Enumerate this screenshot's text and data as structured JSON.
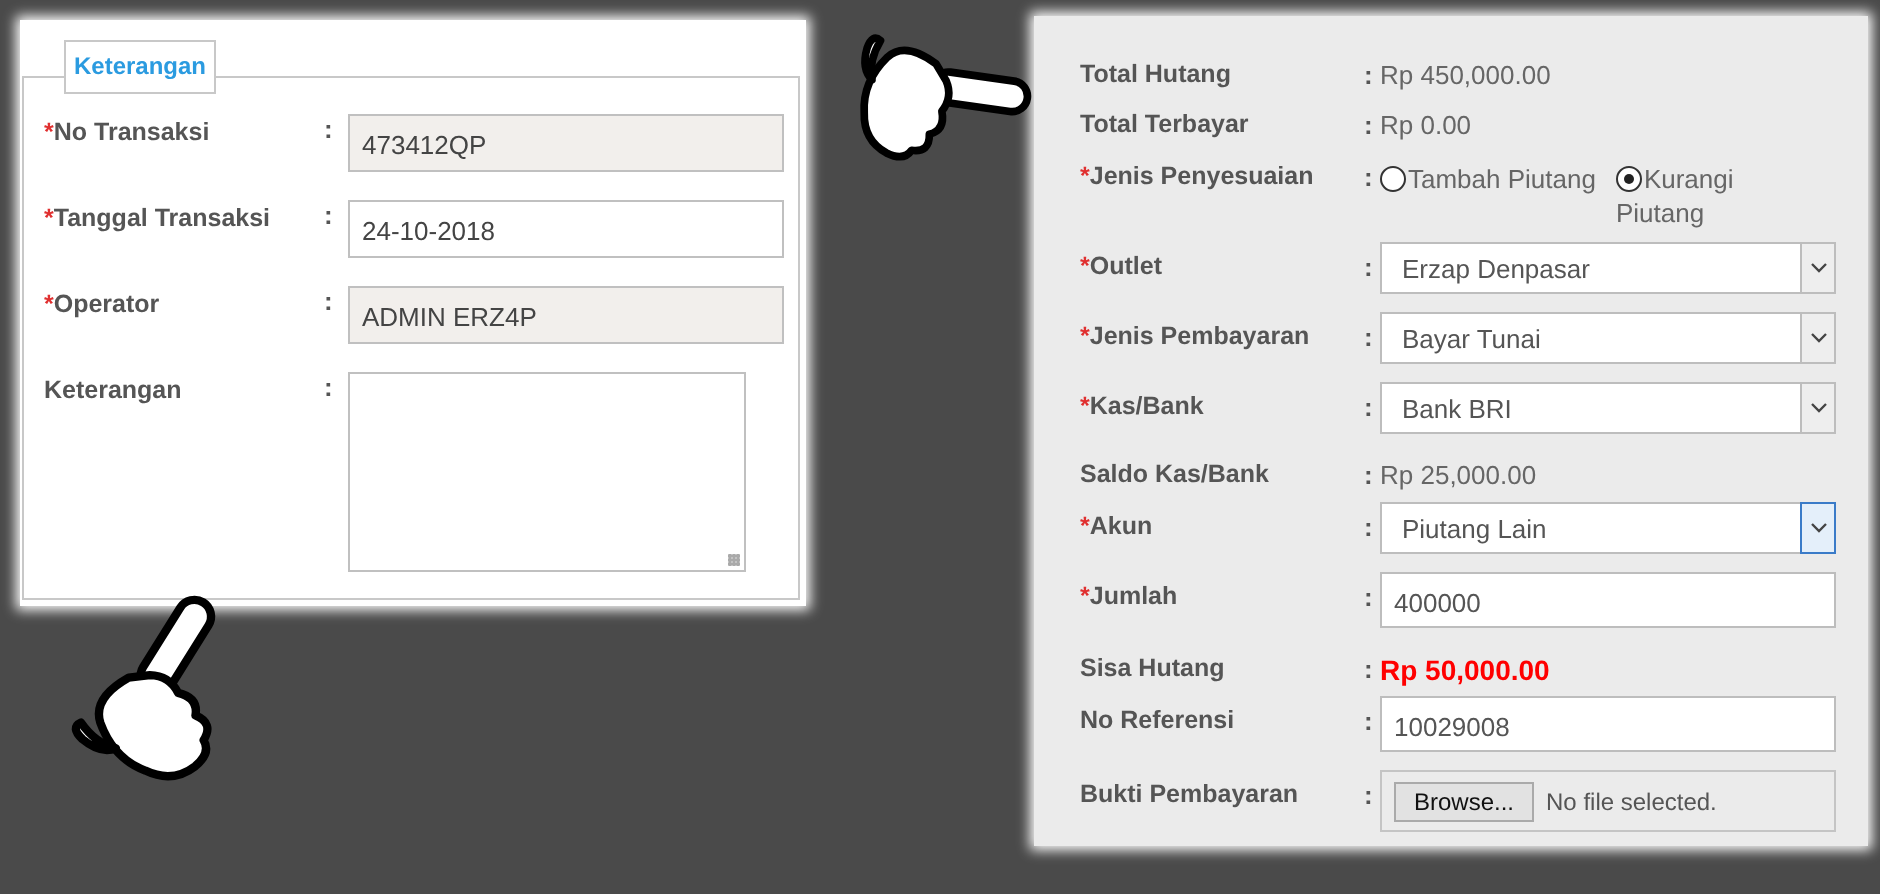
{
  "details_panel": {
    "legend": "Keterangan",
    "fields": [
      {
        "kind": "readonly",
        "required_mark": "*",
        "label": "No Transaksi",
        "separator": ":",
        "value": "473412QP"
      },
      {
        "kind": "input",
        "required_mark": "*",
        "label": "Tanggal Transaksi",
        "separator": ":",
        "value": "24-10-2018"
      },
      {
        "kind": "readonly",
        "required_mark": "*",
        "label": "Operator",
        "separator": ":",
        "value": "ADMIN ERZ4P"
      },
      {
        "kind": "textarea",
        "label": "Keterangan",
        "separator": ":"
      }
    ]
  },
  "payment_panel": {
    "rows": [
      {
        "kind": "text",
        "label": "Total Hutang",
        "separator": ":",
        "value": "Rp 450,000.00",
        "emphasis": false
      },
      {
        "kind": "text",
        "label": "Total Terbayar",
        "separator": ":",
        "value": "Rp 0.00",
        "emphasis": false
      },
      {
        "kind": "radio",
        "required_mark": "*",
        "label": "Jenis Penyesuaian",
        "separator": ":",
        "options": [
          {
            "label": "Tambah Piutang",
            "selected": false
          },
          {
            "label": "Kurangi Piutang",
            "selected": true
          }
        ]
      },
      {
        "kind": "select",
        "required_mark": "*",
        "label": "Outlet",
        "separator": ":",
        "value": "Erzap Denpasar",
        "focused": false
      },
      {
        "kind": "select",
        "required_mark": "*",
        "label": "Jenis Pembayaran",
        "separator": ":",
        "value": "Bayar Tunai",
        "focused": false
      },
      {
        "kind": "select",
        "required_mark": "*",
        "label": "Kas/Bank",
        "separator": ":",
        "value": "Bank BRI",
        "focused": false
      },
      {
        "kind": "text",
        "label": "Saldo Kas/Bank",
        "separator": ":",
        "value": "Rp 25,000.00",
        "emphasis": false
      },
      {
        "kind": "select",
        "required_mark": "*",
        "label": "Akun",
        "separator": ":",
        "value": "Piutang Lain",
        "focused": true
      },
      {
        "kind": "input",
        "required_mark": "*",
        "label": "Jumlah",
        "separator": ":",
        "value": "400000"
      },
      {
        "kind": "text",
        "label": "Sisa Hutang",
        "separator": ":",
        "value": "Rp 50,000.00",
        "emphasis": true
      },
      {
        "kind": "input",
        "label": "No Referensi",
        "separator": ":",
        "value": "10029008"
      },
      {
        "kind": "file",
        "label": "Bukti Pembayaran",
        "separator": ":",
        "button": "Browse...",
        "status": "No file selected."
      }
    ]
  }
}
